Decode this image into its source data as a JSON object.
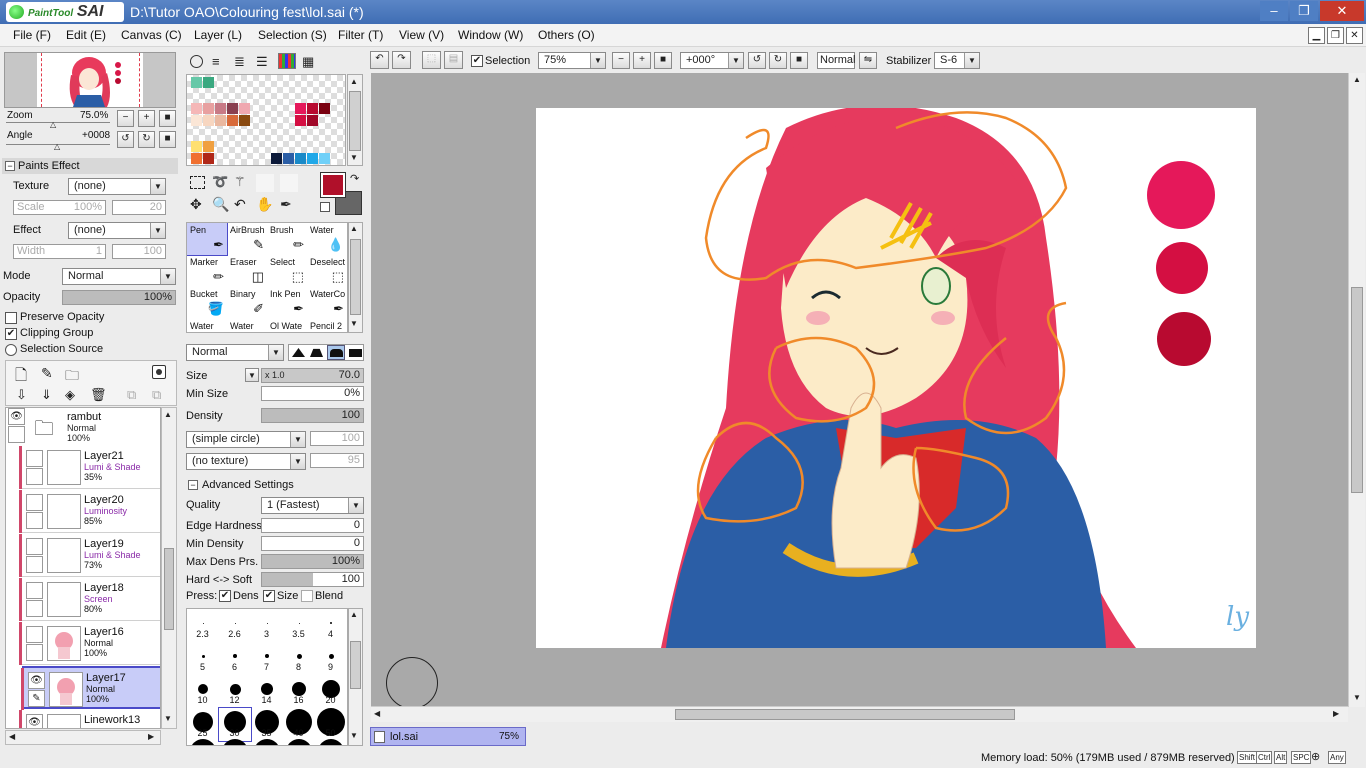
{
  "app": {
    "logo_brand": "PaintTool",
    "logo_name": "SAI",
    "title": "D:\\Tutor OAO\\Colouring fest\\lol.sai (*)"
  },
  "window_buttons": {
    "minimize": "–",
    "restore": "❐",
    "close": "✕"
  },
  "menu": [
    "File (F)",
    "Edit (E)",
    "Canvas (C)",
    "Layer (L)",
    "Selection (S)",
    "Filter (T)",
    "View (V)",
    "Window (W)",
    "Others (O)"
  ],
  "navigator": {
    "zoom_label": "Zoom",
    "zoom_value": "75.0%",
    "angle_label": "Angle",
    "angle_value": "+0008"
  },
  "paints_effect": {
    "header": "Paints Effect",
    "texture_label": "Texture",
    "texture_value": "(none)",
    "scale_label": "Scale",
    "scale_value": "100%",
    "scale_num": "20",
    "effect_label": "Effect",
    "effect_value": "(none)",
    "width_label": "Width",
    "width_value": "1",
    "width_num": "100"
  },
  "layer_props": {
    "mode_label": "Mode",
    "mode_value": "Normal",
    "opacity_label": "Opacity",
    "opacity_value": "100%",
    "preserve_opacity": "Preserve Opacity",
    "clipping_group": "Clipping Group",
    "selection_source": "Selection Source"
  },
  "layers": {
    "folder": {
      "name": "rambut",
      "mode": "Normal",
      "opacity": "100%"
    },
    "items": [
      {
        "name": "Layer21",
        "mode": "Lumi & Shade",
        "opacity": "35%"
      },
      {
        "name": "Layer20",
        "mode": "Luminosity",
        "opacity": "85%"
      },
      {
        "name": "Layer19",
        "mode": "Lumi & Shade",
        "opacity": "73%"
      },
      {
        "name": "Layer18",
        "mode": "Screen",
        "opacity": "80%"
      },
      {
        "name": "Layer16",
        "mode": "Normal",
        "opacity": "100%"
      },
      {
        "name": "Layer17",
        "mode": "Normal",
        "opacity": "100%"
      }
    ],
    "partial": "Linework13"
  },
  "palette": {
    "colors_top": [
      "#66c8a8",
      "#3aa880"
    ],
    "primary_color": "#b0102a",
    "secondary_color": "#666666"
  },
  "tools": [
    [
      "Pen",
      "AirBrush",
      "Brush",
      "Water"
    ],
    [
      "Marker",
      "Eraser",
      "Select",
      "Deselect"
    ],
    [
      "Bucket",
      "Binary",
      "Ink Pen",
      "WaterCo"
    ],
    [
      "Water",
      "Water",
      "Ol Wate",
      "Pencil 2"
    ]
  ],
  "brush": {
    "blend_mode": "Normal",
    "size_label": "Size",
    "size_mult": "x 1.0",
    "size_value": "70.0",
    "min_size_label": "Min Size",
    "min_size_value": "0%",
    "density_label": "Density",
    "density_value": "100",
    "shape": "(simple circle)",
    "shape_num": "100",
    "texture": "(no texture)",
    "texture_num": "95",
    "advanced_header": "Advanced Settings",
    "quality_label": "Quality",
    "quality_value": "1 (Fastest)",
    "edge_hardness_label": "Edge Hardness",
    "edge_hardness_value": "0",
    "min_density_label": "Min Density",
    "min_density_value": "0",
    "max_dens_label": "Max Dens Prs.",
    "max_dens_value": "100%",
    "hard_soft_label": "Hard <-> Soft",
    "hard_soft_value": "100",
    "press_label": "Press:",
    "dens_label": "Dens",
    "size_chk_label": "Size",
    "blend_label": "Blend",
    "sizes": [
      "2.3",
      "2.6",
      "3",
      "3.5",
      "4",
      "5",
      "6",
      "7",
      "8",
      "9",
      "10",
      "12",
      "14",
      "16",
      "20",
      "25",
      "30",
      "35",
      "40",
      "50"
    ]
  },
  "toolbar": {
    "selection_label": "Selection",
    "zoom_value": "75%",
    "rotation_value": "+000°",
    "blend_value": "Normal",
    "stabilizer_label": "Stabilizer",
    "stabilizer_value": "S-6"
  },
  "canvas": {
    "swatches": [
      "#e5185a",
      "#d40f42",
      "#b80a30"
    ],
    "signature": "ly"
  },
  "document_tab": {
    "name": "lol.sai",
    "zoom": "75%"
  },
  "status": {
    "memory": "Memory load: 50% (179MB used / 879MB reserved)",
    "keys": [
      "Shift",
      "Ctrl",
      "Alt",
      "SPC",
      "Any"
    ]
  }
}
